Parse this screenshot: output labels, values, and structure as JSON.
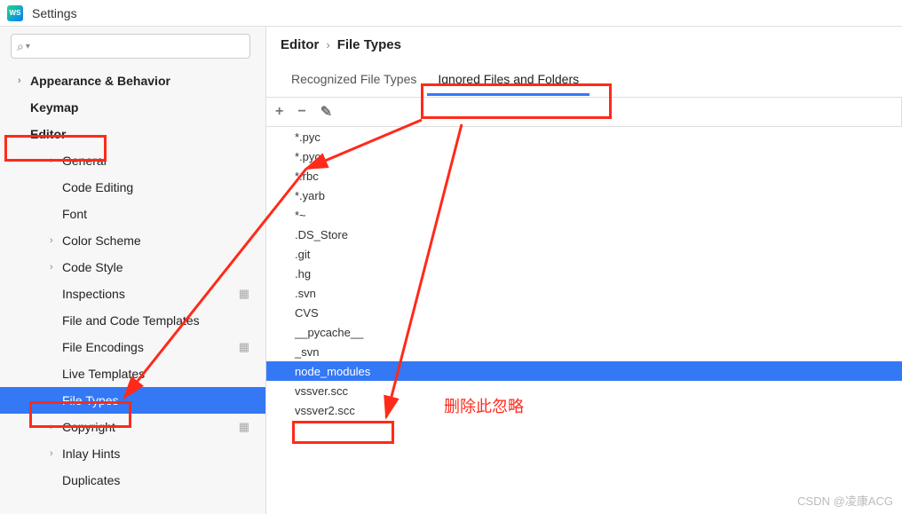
{
  "window": {
    "title": "Settings",
    "logo_text": "WS"
  },
  "sidebar": {
    "search_placeholder": "",
    "items": [
      {
        "label": "Appearance & Behavior",
        "chev": "›",
        "bold": true
      },
      {
        "label": "Keymap",
        "chev": "",
        "bold": true
      },
      {
        "label": "Editor",
        "chev": "⌄",
        "bold": true
      },
      {
        "label": "General",
        "chev": "›"
      },
      {
        "label": "Code Editing",
        "chev": ""
      },
      {
        "label": "Font",
        "chev": ""
      },
      {
        "label": "Color Scheme",
        "chev": "›"
      },
      {
        "label": "Code Style",
        "chev": "›"
      },
      {
        "label": "Inspections",
        "chev": "",
        "gear": true
      },
      {
        "label": "File and Code Templates",
        "chev": ""
      },
      {
        "label": "File Encodings",
        "chev": "",
        "gear": true
      },
      {
        "label": "Live Templates",
        "chev": ""
      },
      {
        "label": "File Types",
        "chev": "",
        "selected": true
      },
      {
        "label": "Copyright",
        "chev": "›",
        "gear": true
      },
      {
        "label": "Inlay Hints",
        "chev": "›"
      },
      {
        "label": "Duplicates",
        "chev": ""
      }
    ]
  },
  "breadcrumb": {
    "a": "Editor",
    "b": "File Types"
  },
  "tabs": [
    {
      "label": "Recognized File Types",
      "active": false
    },
    {
      "label": "Ignored Files and Folders",
      "active": true
    }
  ],
  "toolbar": {
    "add": "+",
    "remove": "−",
    "edit": "✎"
  },
  "ignored_list": [
    "*.pyc",
    "*.pyo",
    "*.rbc",
    "*.yarb",
    "*~",
    ".DS_Store",
    ".git",
    ".hg",
    ".svn",
    "CVS",
    "__pycache__",
    "_svn",
    "node_modules",
    "vssver.scc",
    "vssver2.scc"
  ],
  "ignored_selected_index": 12,
  "annotation_text": "删除此忽略",
  "watermark": "CSDN @凌康ACG"
}
